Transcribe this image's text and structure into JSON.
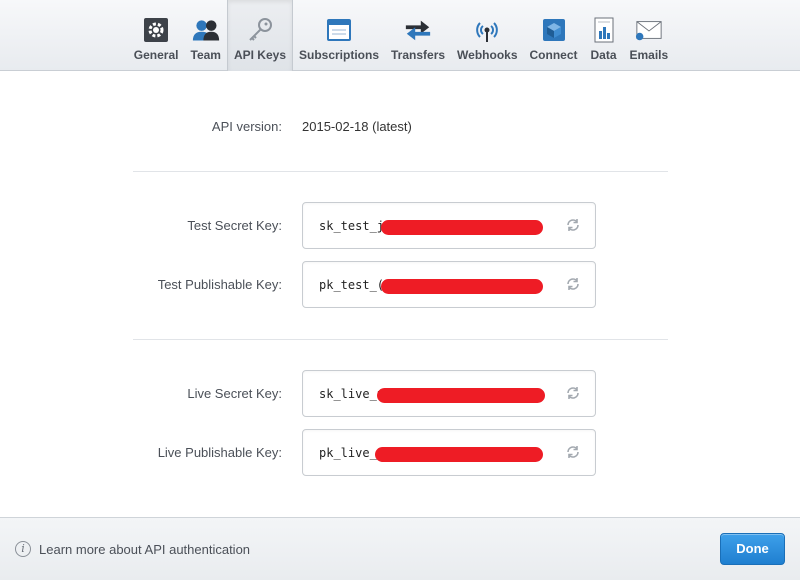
{
  "tabs": [
    {
      "label": "General",
      "icon": "gear-icon"
    },
    {
      "label": "Team",
      "icon": "team-icon"
    },
    {
      "label": "API Keys",
      "icon": "key-icon",
      "active": true
    },
    {
      "label": "Subscriptions",
      "icon": "window-icon"
    },
    {
      "label": "Transfers",
      "icon": "arrows-icon"
    },
    {
      "label": "Webhooks",
      "icon": "broadcast-icon"
    },
    {
      "label": "Connect",
      "icon": "cube-icon"
    },
    {
      "label": "Data",
      "icon": "document-chart-icon"
    },
    {
      "label": "Emails",
      "icon": "envelope-icon"
    }
  ],
  "api_version": {
    "label": "API version:",
    "value": "2015-02-18 (latest)"
  },
  "keys": {
    "test_secret": {
      "label": "Test Secret Key:",
      "prefix": "sk_test_j"
    },
    "test_publishable": {
      "label": "Test Publishable Key:",
      "prefix": "pk_test_("
    },
    "live_secret": {
      "label": "Live Secret Key:",
      "prefix": "sk_live_u"
    },
    "live_publishable": {
      "label": "Live Publishable Key:",
      "prefix": "pk_live_"
    }
  },
  "footer": {
    "link": "Learn more about API authentication",
    "done_label": "Done"
  },
  "colors": {
    "redaction": "#ee1c25",
    "accent": "#1f7fd0"
  }
}
